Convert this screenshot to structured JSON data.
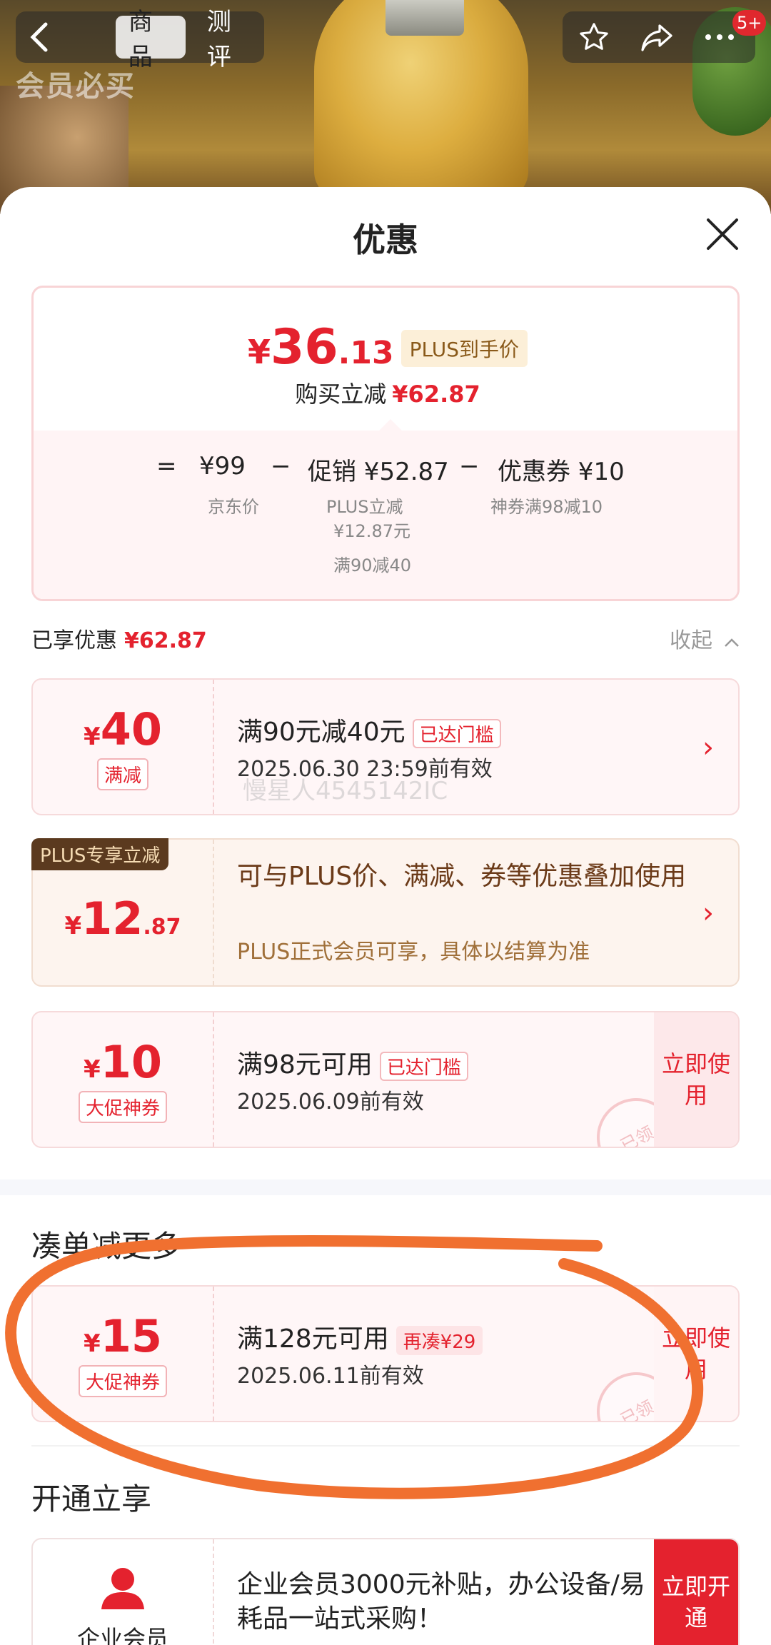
{
  "nav": {
    "tabs": [
      "商品",
      "测评"
    ],
    "active_tab": "商品",
    "member_badge": "会员必买",
    "cart_badge": "5+"
  },
  "sheet": {
    "title": "优惠"
  },
  "summary": {
    "price_currency": "¥",
    "price_int": "36",
    "price_dec": ".13",
    "plus_tag": "PLUS到手价",
    "reduce_label": "购买立减",
    "reduce_amount": "¥62.87",
    "formula": {
      "eq": "=",
      "base": "¥99",
      "minus1": "−",
      "promo": "促销 ¥52.87",
      "minus2": "−",
      "coupon": "优惠券 ¥10"
    },
    "base_sub": "京东价",
    "promo_sub1": "PLUS立减",
    "promo_sub2": "¥12.87元",
    "promo_sub3": "满90减40",
    "coupon_sub": "神券满98减10"
  },
  "enjoyed": {
    "label": "已享优惠",
    "amount": "¥62.87",
    "collapse": "收起"
  },
  "coupons": [
    {
      "currency": "¥",
      "amount": "40",
      "decimal": "",
      "type": "满减",
      "title": "满90元减40元",
      "tag": "已达门槛",
      "validity": "2025.06.30 23:59前有效"
    },
    {
      "currency": "¥",
      "amount": "12",
      "decimal": ".87",
      "corner_label": "PLUS专享立减",
      "title": "可与PLUS价、满减、券等优惠叠加使用",
      "sub": "PLUS正式会员可享，具体以结算为准"
    },
    {
      "currency": "¥",
      "amount": "10",
      "decimal": "",
      "type": "大促神券",
      "title": "满98元可用",
      "tag": "已达门槛",
      "validity": "2025.06.09前有效",
      "action": "立即使用",
      "stamp": "已领"
    }
  ],
  "more_section": {
    "title": "凑单减更多",
    "coupon": {
      "currency": "¥",
      "amount": "15",
      "type": "大促神券",
      "title": "满128元可用",
      "tag": "再凑¥29",
      "validity": "2025.06.11前有效",
      "action": "立即使用",
      "stamp": "已领"
    }
  },
  "open_section": {
    "title": "开通立享",
    "label": "企业会员",
    "text": "企业会员3000元补贴，办公设备/易耗品一站式采购！",
    "action": "立即开通"
  },
  "watermark": "慢星人4545142IC",
  "colors": {
    "accent": "#e4222e",
    "annotation": "#f07030"
  }
}
